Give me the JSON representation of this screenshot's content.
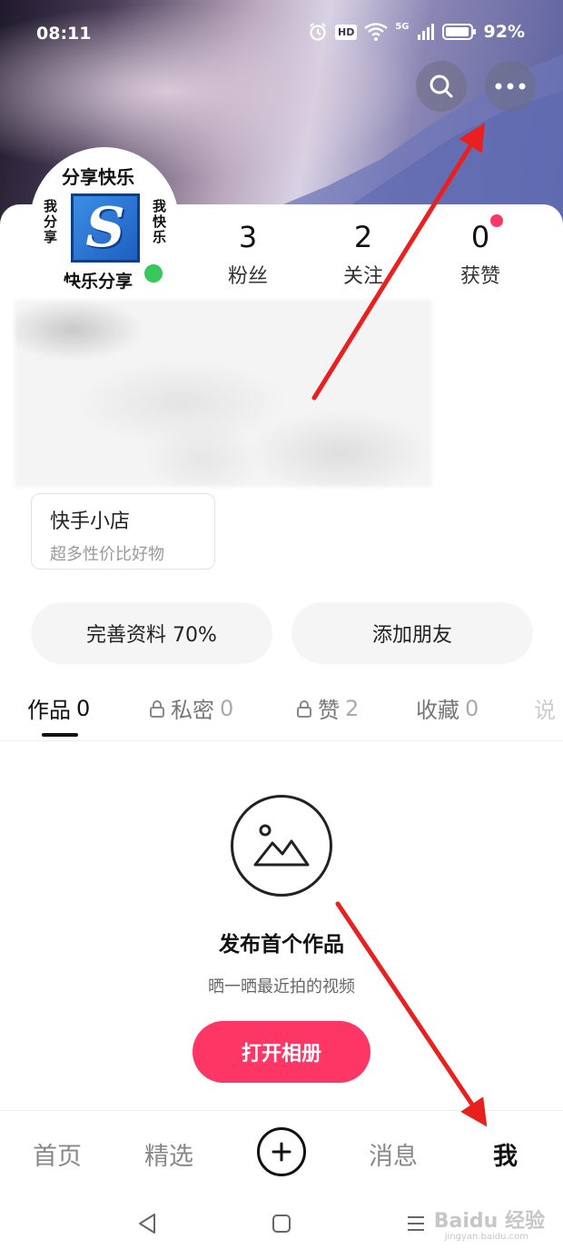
{
  "status_bar": {
    "time": "08:11",
    "hd_label": "HD",
    "network_label": "5G",
    "battery": "92%"
  },
  "header": {
    "search_icon": "search-icon",
    "more_icon": "more-dots-icon"
  },
  "profile": {
    "avatar": {
      "top": "分享快乐",
      "left": "我分享",
      "right": "我快乐",
      "bottom": "快乐分享",
      "logo_letter": "S"
    },
    "stats": [
      {
        "value": "3",
        "label": "粉丝"
      },
      {
        "value": "2",
        "label": "关注"
      },
      {
        "value": "0",
        "label": "获赞"
      }
    ],
    "shop": {
      "title": "快手小店",
      "subtitle": "超多性价比好物"
    }
  },
  "actions": {
    "complete_profile": "完善资料 70%",
    "add_friends": "添加朋友"
  },
  "tabs": [
    {
      "label": "作品",
      "count": "0",
      "locked": false
    },
    {
      "label": "私密",
      "count": "0",
      "locked": true
    },
    {
      "label": "赞",
      "count": "2",
      "locked": true
    },
    {
      "label": "收藏",
      "count": "0",
      "locked": false
    },
    {
      "label": "说",
      "count": "",
      "locked": false
    }
  ],
  "empty_state": {
    "icon": "image-icon",
    "title": "发布首个作品",
    "subtitle": "晒一晒最近拍的视频",
    "button": "打开相册"
  },
  "bottom_nav": {
    "home": "首页",
    "featured": "精选",
    "messages": "消息",
    "me": "我"
  },
  "watermark": {
    "brand": "Baidu 经验",
    "url": "jingyan.baidu.com"
  },
  "colors": {
    "accent": "#fe3666",
    "online": "#38c75a",
    "annotation_arrow": "#e8201f"
  }
}
